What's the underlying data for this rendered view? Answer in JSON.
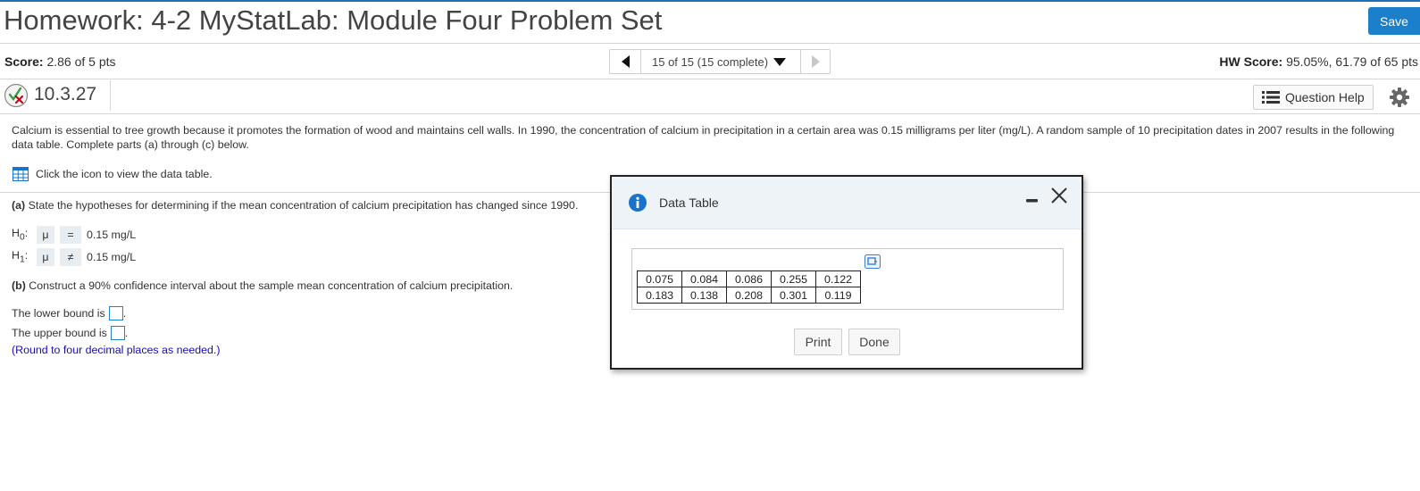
{
  "header": {
    "title": "Homework: 4-2 MyStatLab: Module Four Problem Set",
    "save_label": "Save"
  },
  "scorebar": {
    "score_label": "Score:",
    "score_value": "2.86 of 5 pts",
    "nav_text": "15 of 15 (15 complete)",
    "hw_score_label": "HW Score:",
    "hw_score_value": "95.05%, 61.79 of 65 pts"
  },
  "question": {
    "number": "10.3.27",
    "status_icon": "partial-credit-icon",
    "help_label": "Question Help",
    "text": "Calcium is essential to tree growth because it promotes the formation of wood and maintains cell walls. In 1990, the concentration of calcium in precipitation in a certain area was 0.15 milligrams per liter (mg/L). A random sample of 10 precipitation dates in 2007 results in the following data table. Complete parts (a) through (c) below.",
    "data_link": "Click the icon to view the data table.",
    "part_a_label": "(a)",
    "part_a_text": "State the hypotheses for determining if the mean concentration of calcium precipitation has changed since 1990.",
    "h0": {
      "sym": "H",
      "sub": "0",
      "colon": ":",
      "param": "μ",
      "op": "=",
      "value": "0.15 mg/L"
    },
    "h1": {
      "sym": "H",
      "sub": "1",
      "colon": ":",
      "param": "μ",
      "op": "≠",
      "value": "0.15 mg/L"
    },
    "part_b_label": "(b)",
    "part_b_text": "Construct a 90% confidence interval about the sample mean concentration of calcium precipitation.",
    "lower_label": "The lower bound is",
    "upper_label": "The upper bound is",
    "period": ".",
    "round_note": "(Round to four decimal places as needed.)"
  },
  "dialog": {
    "title": "Data Table",
    "rows": [
      [
        "0.075",
        "0.084",
        "0.086",
        "0.255",
        "0.122"
      ],
      [
        "0.183",
        "0.138",
        "0.208",
        "0.301",
        "0.119"
      ]
    ],
    "print_label": "Print",
    "done_label": "Done"
  },
  "colors": {
    "accent": "#1b7fcc",
    "top_border": "#1f6fb2",
    "info": "#1a73c8",
    "link": "#1a0dab"
  }
}
